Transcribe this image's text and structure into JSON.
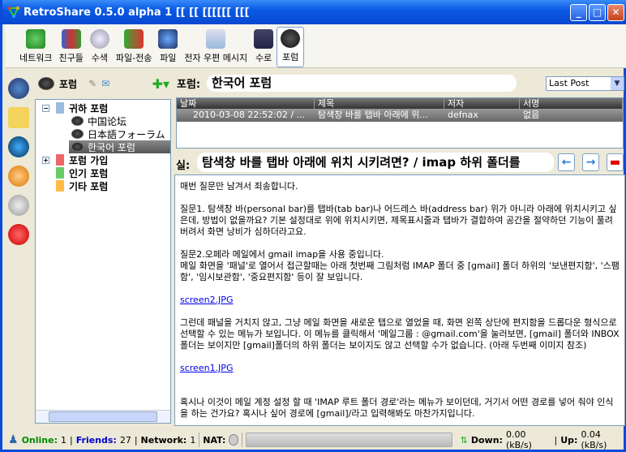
{
  "window": {
    "title": "RetroShare 0.5.0 alpha 1 [[ [[ [[[[[[ [[["
  },
  "toolbar": [
    {
      "label": "네트워크",
      "icon": "network-icon"
    },
    {
      "label": "친구들",
      "icon": "friends-icon"
    },
    {
      "label": "수색",
      "icon": "search-icon"
    },
    {
      "label": "파일-전송",
      "icon": "transfer-icon"
    },
    {
      "label": "파일",
      "icon": "files-icon"
    },
    {
      "label": "전자 우편 메시지",
      "icon": "messages-icon"
    },
    {
      "label": "수로",
      "icon": "channels-icon"
    },
    {
      "label": "포럼",
      "icon": "forums-icon"
    }
  ],
  "forums": {
    "header": "포럼",
    "tree": [
      {
        "label": "귀하 포럼",
        "children": [
          "中国论坛",
          "日本語フォーラム",
          "한국어 포럼"
        ]
      },
      {
        "label": "포럼 가입"
      },
      {
        "label": "인기 포럼"
      },
      {
        "label": "기타 포럼"
      }
    ]
  },
  "main": {
    "forum_label": "포럼:",
    "forum_name": "한국어 포럼",
    "sort": "Last Post",
    "columns": [
      "날짜",
      "제목",
      "저자",
      "서명"
    ],
    "rows": [
      [
        "2010-03-08 22:52:02 / ...",
        "탐색창 바를 탭바 아래에 위...",
        "defnax",
        "없음"
      ]
    ],
    "subject_label": "실:",
    "subject": "탐색창 바를 탭바 아래에 위치 시키려면? / imap 하위 폴더를",
    "message": [
      "매번 질문만 남겨서 죄송합니다.",
      "질문1. 탐색창 바(personal bar)를 탭바(tab bar)나 어드레스 바(address bar) 위가 아니라 아래에 위치시키고 싶은데, 방법이 없을까요? 기본 설정대로 위에 위치시키면, 제목표시줄과 탭바가 결합하여 공간을 절약하던 기능이 풀려 버려서 화면 낭비가 심하더라고요.",
      "질문2.오페라 메일에서 gmail imap을 사용 중입니다.\n메일 화면을 '패널'로 열어서 접근할때는 아래 첫번째 그림처럼 IMAP 폴더 중 [gmail] 폴더 하위의 '보낸편지함', '스팸함', '임시보관함', '중요편지함' 등이 잘 보입니다.",
      "screen2.JPG",
      "그런데 패널을 거치지 않고, 그냥 메일 화면을 새로운 탭으로 열었을 때, 화면 왼쪽 상단에 편지함을 드롭다운 형식으로 선택할 수 있는 메뉴가 보입니다. 이 메뉴를 클릭해서 '메일그룹 : @gmail.com'을 눌러보면, [gmail] 폴더와 INBOX폴더는 보이지만 [gmail]폴더의 하위 폴더는 보이지도 않고 선택할 수가 없습니다. (아래 두번째 이미지 참조)",
      "screen1.JPG",
      "혹시나 이것이 메일 계정 설정 할 때 'IMAP 루트 폴더 경로'라는 메뉴가 보이던데, 거기서 어떤 경로를 넣어 줘야 인식을 하는 건가요? 혹시나 싶어 경로에 [gmail]/라고 입력해봐도 마찬가지입니다."
    ]
  },
  "status": {
    "online_label": "Online:",
    "online": "1",
    "friends_label": "Friends:",
    "friends": "27",
    "network_label": "Network:",
    "network": "1",
    "nat_label": "NAT:",
    "down_label": "Down:",
    "down": "0.00 (kB/s)",
    "up_label": "Up:",
    "up": "0.04 (kB/s)"
  }
}
